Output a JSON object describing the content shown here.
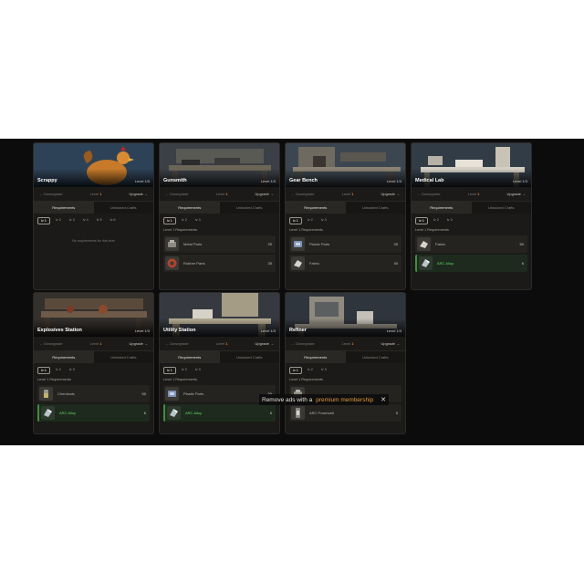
{
  "common": {
    "downgrade": "← Downgrade",
    "level_word": "Level",
    "upgrade": "Upgrade →",
    "tab_requirements": "Requirements",
    "tab_unlocked": "Unlocked Crafts",
    "req_heading": "Level 1 Requirements"
  },
  "cards": [
    {
      "name": "Scrappy",
      "level_label": "Level 1/5",
      "current_level": "1",
      "chips": [
        "lv 1",
        "lv 2",
        "lv 3",
        "lv 4",
        "lv 5",
        "lv 6"
      ],
      "empty_text": "No requirements for this level",
      "items": []
    },
    {
      "name": "Gunsmith",
      "level_label": "Level 1/3",
      "current_level": "1",
      "chips": [
        "lv 1",
        "lv 2",
        "lv 3"
      ],
      "items": [
        {
          "name": "Metal Parts",
          "qty": "20",
          "icon": "metal-parts-icon"
        },
        {
          "name": "Rubber Parts",
          "qty": "30",
          "icon": "rubber-parts-icon"
        }
      ]
    },
    {
      "name": "Gear Bench",
      "level_label": "Level 1/3",
      "current_level": "1",
      "chips": [
        "lv 1",
        "lv 2",
        "lv 3"
      ],
      "items": [
        {
          "name": "Plastic Parts",
          "qty": "25",
          "icon": "plastic-parts-icon"
        },
        {
          "name": "Fabric",
          "qty": "40",
          "icon": "fabric-icon"
        }
      ]
    },
    {
      "name": "Medical Lab",
      "level_label": "Level 1/3",
      "current_level": "1",
      "chips": [
        "lv 1",
        "lv 2",
        "lv 3"
      ],
      "items": [
        {
          "name": "Fabric",
          "qty": "50",
          "icon": "fabric-icon"
        },
        {
          "name": "ARC Alloy",
          "qty": "6",
          "icon": "arc-alloy-icon",
          "highlight": true
        }
      ]
    },
    {
      "name": "Explosives Station",
      "level_label": "Level 1/3",
      "current_level": "1",
      "chips": [
        "lv 1",
        "lv 2",
        "lv 3"
      ],
      "items": [
        {
          "name": "Chemicals",
          "qty": "50",
          "icon": "chemicals-icon"
        },
        {
          "name": "ARC Alloy",
          "qty": "6",
          "icon": "arc-alloy-icon",
          "highlight": true
        }
      ]
    },
    {
      "name": "Utility Station",
      "level_label": "Level 1/3",
      "current_level": "1",
      "chips": [
        "lv 1",
        "lv 2",
        "lv 3"
      ],
      "items": [
        {
          "name": "Plastic Parts",
          "qty": "50",
          "icon": "plastic-parts-icon"
        },
        {
          "name": "ARC Alloy",
          "qty": "6",
          "icon": "arc-alloy-icon",
          "highlight": true
        }
      ]
    },
    {
      "name": "Refiner",
      "level_label": "Level 1/3",
      "current_level": "1",
      "chips": [
        "lv 1",
        "lv 2",
        "lv 3"
      ],
      "items": [
        {
          "name": "",
          "qty": "",
          "icon": "metal-parts-icon"
        },
        {
          "name": "ARC Powercell",
          "qty": "5",
          "icon": "arc-powercell-icon"
        }
      ]
    }
  ],
  "ad_banner": {
    "prefix": "Remove ads with a",
    "highlight": "premium membership",
    "close": "✕"
  },
  "colors": {
    "accent_orange": "#e07b22",
    "highlight_green": "#5ddc5d",
    "background": "#0c0c0c",
    "card": "#1b1a18"
  }
}
